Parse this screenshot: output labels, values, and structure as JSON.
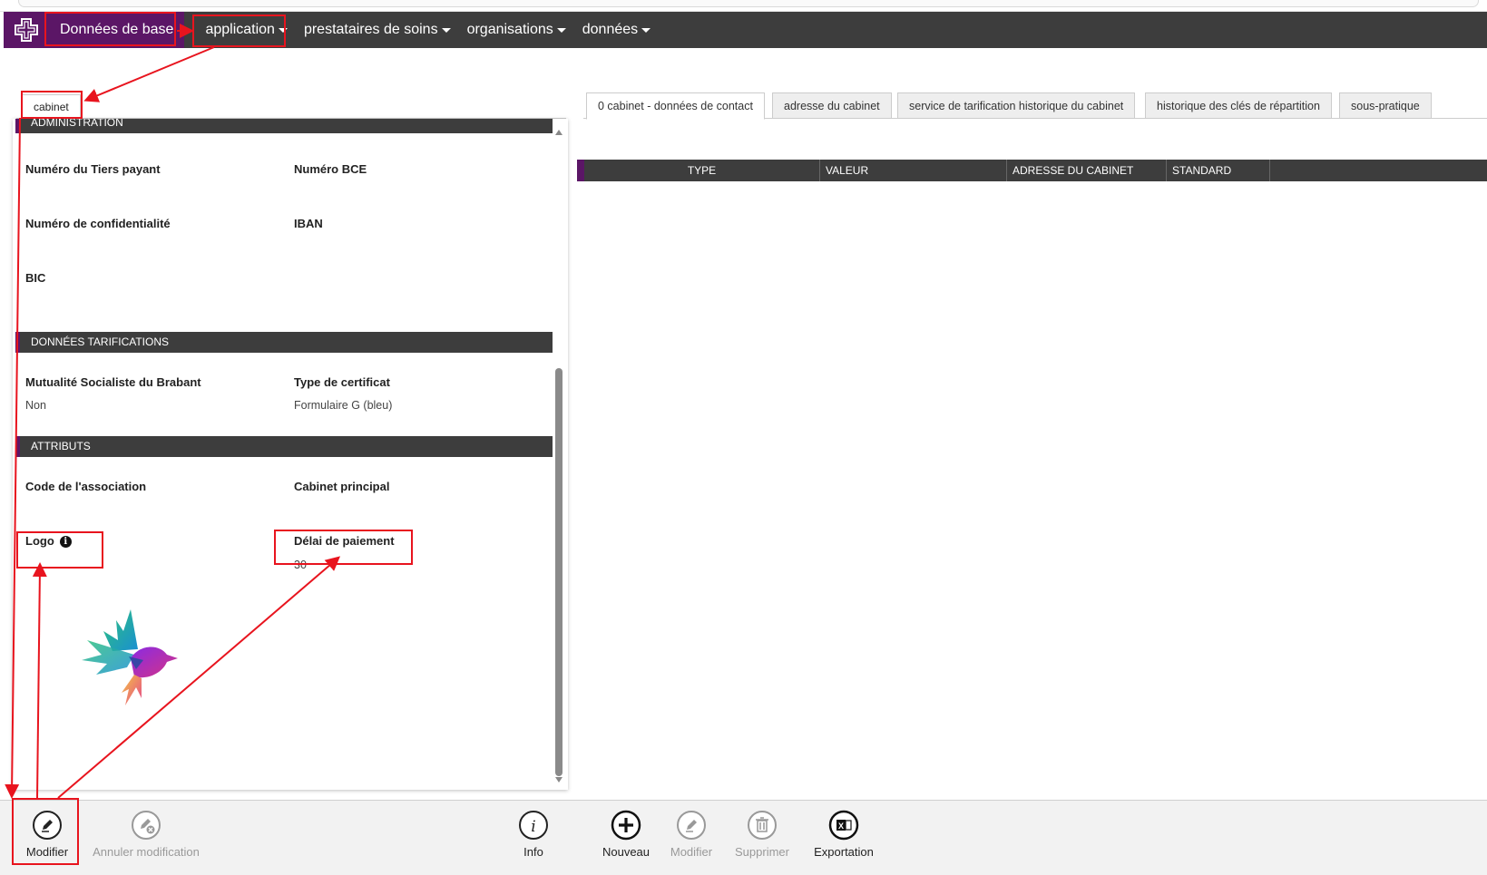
{
  "nav": {
    "brand_icon": "medical-cross-icon",
    "items": [
      {
        "label": "Données de base"
      },
      {
        "label": "application"
      },
      {
        "label": "prestataires de soins"
      },
      {
        "label": "organisations"
      },
      {
        "label": "données"
      }
    ]
  },
  "left_tab": {
    "label": "cabinet"
  },
  "sections": {
    "administration": {
      "title": "ADMINISTRATION",
      "fields": [
        {
          "label": "Numéro du Tiers payant",
          "value": ""
        },
        {
          "label": "Numéro BCE",
          "value": ""
        },
        {
          "label": "Numéro de confidentialité",
          "value": ""
        },
        {
          "label": "IBAN",
          "value": ""
        },
        {
          "label": "BIC",
          "value": ""
        }
      ]
    },
    "tarifications": {
      "title": "DONNÉES TARIFICATIONS",
      "fields": [
        {
          "label": "Mutualité Socialiste du Brabant",
          "value": "Non"
        },
        {
          "label": "Type de certificat",
          "value": "Formulaire G (bleu)"
        }
      ]
    },
    "attributs": {
      "title": "ATTRIBUTS",
      "fields": [
        {
          "label": "Code de l'association",
          "value": ""
        },
        {
          "label": "Cabinet principal",
          "value": ""
        },
        {
          "label": "Logo",
          "value": ""
        },
        {
          "label": "Délai de paiement",
          "value": "30"
        }
      ],
      "logo_info_icon": "info-icon"
    }
  },
  "right_tabs": [
    {
      "label": "0 cabinet - données de contact"
    },
    {
      "label": "adresse du cabinet"
    },
    {
      "label": "service de tarification historique du cabinet"
    },
    {
      "label": "historique des clés de répartition"
    },
    {
      "label": "sous-pratique"
    }
  ],
  "grid": {
    "columns": [
      "TYPE",
      "VALEUR",
      "ADRESSE DU CABINET",
      "STANDARD"
    ],
    "rows": []
  },
  "toolbar": {
    "modifier": {
      "label": "Modifier",
      "icon": "pencil-icon"
    },
    "annuler": {
      "label": "Annuler modification",
      "icon": "undo-edit-icon"
    },
    "info": {
      "label": "Info",
      "icon": "info-icon"
    },
    "nouveau": {
      "label": "Nouveau",
      "icon": "plus-icon"
    },
    "modifier2": {
      "label": "Modifier",
      "icon": "pencil-icon"
    },
    "supprimer": {
      "label": "Supprimer",
      "icon": "trash-icon"
    },
    "exportation": {
      "label": "Exportation",
      "icon": "excel-icon"
    }
  },
  "colors": {
    "brand_purple": "#5b1666",
    "header_dark": "#3d3d3d",
    "annotation_red": "#e8141e"
  }
}
